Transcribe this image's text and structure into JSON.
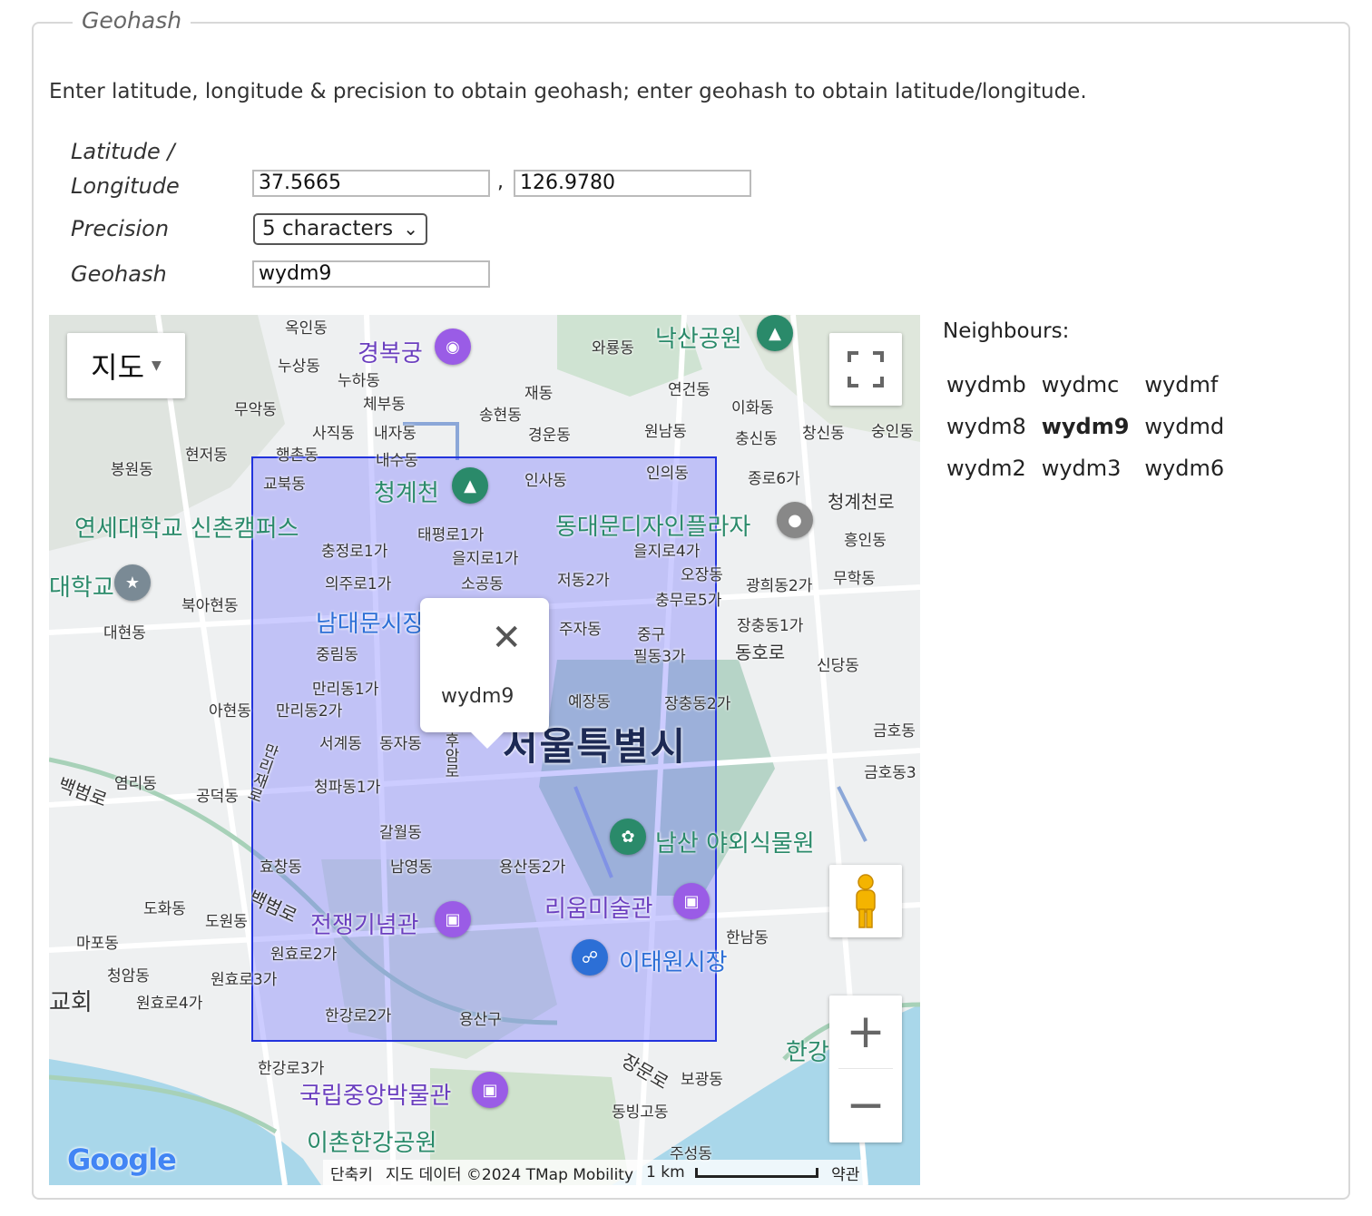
{
  "legend": "Geohash",
  "intro": "Enter latitude, longitude & precision to obtain geohash; enter geohash to obtain latitude/longitude.",
  "labels": {
    "latlon_line1": "Latitude /",
    "latlon_line2": "Longitude",
    "precision": "Precision",
    "geohash": "Geohash"
  },
  "inputs": {
    "latitude": "37.5665",
    "longitude": "126.9780",
    "comma": ",",
    "precision_selected": "5 characters",
    "geohash": "wydm9"
  },
  "map": {
    "map_type_label": "지도",
    "infowindow_text": "wydm9",
    "attribution": {
      "shortcuts": "단축키",
      "data": "지도 데이터 ©2024 TMap Mobility",
      "scale": "1 km",
      "terms": "약관"
    },
    "google_logo": "Google",
    "places": {
      "gyeongbokgung": "경복궁",
      "naksan": "낙산공원",
      "cheonggyecheon": "청계천",
      "ddp": "동대문디자인플라자",
      "yonsei": "연세대학교 신촌캠퍼스",
      "namdaemun": "남대문시장",
      "seoul": "서울특별시",
      "namsan": "남산 야외식물원",
      "leeum": "리움미술관",
      "warmemorial": "전쟁기념관",
      "itaewon": "이태원시장",
      "museum": "국립중앙박물관",
      "ichon": "이촌한강공원",
      "hangang": "한강",
      "univ": "대학교",
      "church": "교회",
      "inwang": "누상동",
      "nuha": "누하동",
      "chebu": "체부동",
      "muak": "무악동",
      "sajik": "사직동",
      "naeja": "내자동",
      "naesu": "내수동",
      "hyeonjeo": "현저동",
      "haengchon": "행촌동",
      "gyobuk": "교북동",
      "bongwon": "봉원동",
      "songhyeon": "송현동",
      "jae": "재동",
      "gyeongun": "경운동",
      "wonnam": "원남동",
      "waryong": "와룡동",
      "yeongeon": "연건동",
      "ihwa": "이화동",
      "chungsin": "충신동",
      "changsin": "창신동",
      "sungin": "숭인동",
      "insa": "인사동",
      "inui": "인의동",
      "jongno6": "종로6가",
      "cheonggyecheonro": "청계천로",
      "heungin": "흥인동",
      "taepyeong": "태평로1가",
      "euljiro1": "을지로1가",
      "euljiro4": "을지로4가",
      "chungjeong": "충정로1가",
      "uiju": "의주로1가",
      "sogong": "소공동",
      "jeodong": "저동2가",
      "ojang": "오장동",
      "gwanghui": "광희동2가",
      "muhak": "무학동",
      "bugahyeon": "북아현동",
      "daehyeon": "대현동",
      "chungmuro": "충무로5가",
      "jujadong": "주자동",
      "jungu": "중구",
      "pildong": "필동3가",
      "jangchung1": "장충동1가",
      "donghoro": "동호로",
      "sindang": "신당동",
      "jungnim": "중림동",
      "malli1": "만리동1가",
      "malli2": "만리동2가",
      "ahyeon": "아현동",
      "yejang": "예장동",
      "jangchung2": "장충동2가",
      "seogye": "서계동",
      "dongja": "동자동",
      "huamro": "후암로",
      "mallijaero": "만리재로",
      "geumho": "금호동",
      "geumho3": "금호동3",
      "yeomni": "염리동",
      "gongdeok": "공덕동",
      "cheongpa": "청파동1가",
      "baekbeomro": "백범로",
      "galwol": "갈월동",
      "hyochang": "효창동",
      "namyeong": "남영동",
      "yongsan2": "용산동2가",
      "dohwa": "도화동",
      "dowon": "도원동",
      "mapo": "마포동",
      "cheongam": "청암동",
      "wonhyo2": "원효로2가",
      "wonhyo3": "원효로3가",
      "wonhyo4": "원효로4가",
      "hannam": "한남동",
      "hangangro2": "한강로2가",
      "yongsangu": "용산구",
      "hangangro3": "한강로3가",
      "jangmunro": "장문로",
      "bogwang": "보광동",
      "dongbinggo": "동빙고동",
      "juseong": "주성동",
      "okin": "옥인동"
    }
  },
  "neighbours": {
    "title": "Neighbours:",
    "cells": [
      "wydmb",
      "wydmc",
      "wydmf",
      "wydm8",
      "wydm9",
      "wydmd",
      "wydm2",
      "wydm3",
      "wydm6"
    ]
  }
}
